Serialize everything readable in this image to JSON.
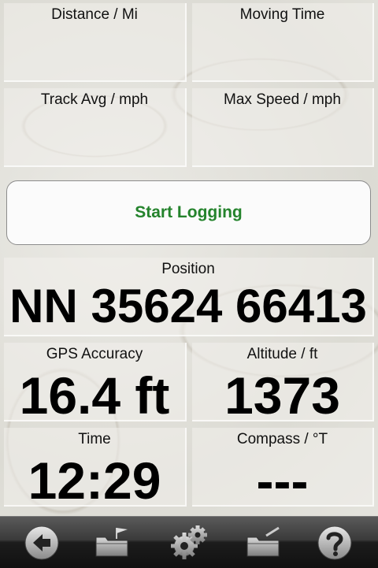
{
  "stats": {
    "distance_label": "Distance / Mi",
    "moving_time_label": "Moving Time",
    "track_avg_label": "Track Avg / mph",
    "max_speed_label": "Max Speed / mph"
  },
  "start_button": {
    "label": "Start Logging",
    "color": "#24832c"
  },
  "position": {
    "label": "Position",
    "value": "NN 35624 66413"
  },
  "gps_accuracy": {
    "label": "GPS Accuracy",
    "value": "16.4 ft"
  },
  "altitude": {
    "label": "Altitude / ft",
    "value": "1373"
  },
  "time": {
    "label": "Time",
    "value": "12:29"
  },
  "compass": {
    "label": "Compass / °T",
    "value": "---"
  },
  "toolbar": {
    "icons": [
      "back-arrow-icon",
      "folder-flag-icon",
      "gear-icon",
      "folder-edit-icon",
      "help-icon"
    ]
  }
}
